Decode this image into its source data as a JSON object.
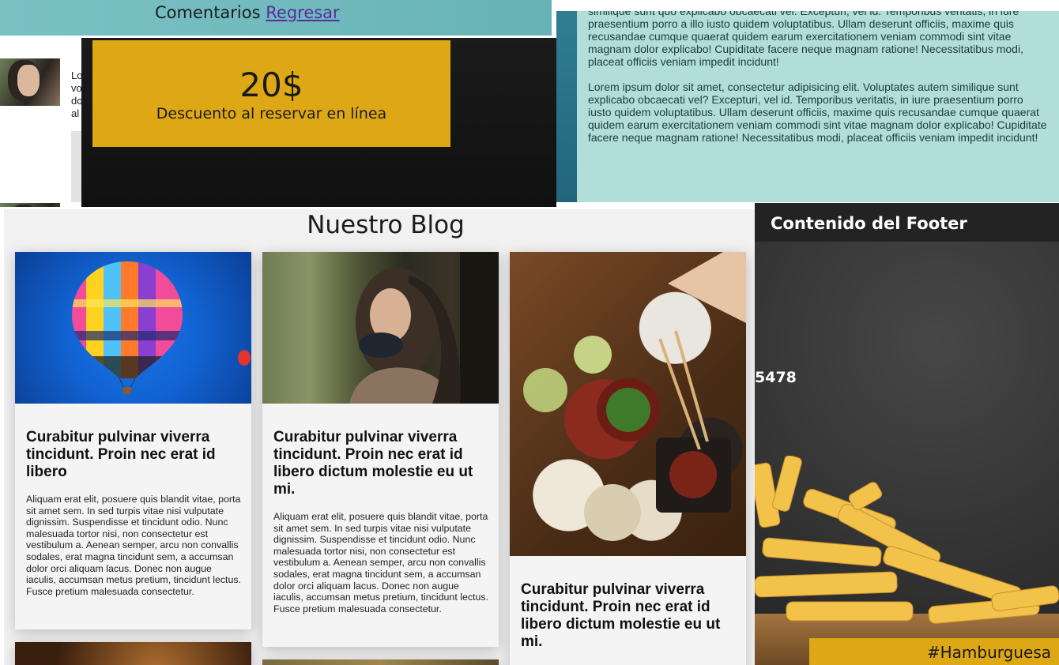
{
  "comments": {
    "title": "Comentarios",
    "back_link": "Regresar",
    "snippet_lines": [
      "Lo",
      "vo",
      "do",
      "al"
    ]
  },
  "discount": {
    "amount": "20$",
    "caption": "Descuento al reservar en línea"
  },
  "lorem": {
    "paragraphs": [
      "similique sunt quo explicabo obcaecati vel. Excepturi, vel id. Temporibus veritatis, in iure",
      "praesentium porro a illo iusto quidem voluptatibus. Ullam deserunt officiis, maxime quis",
      "recusandae cumque quaerat quidem earum exercitationem veniam commodi sint vitae",
      "magnam dolor explicabo! Cupiditate facere neque magnam ratione! Necessitatibus modi,",
      "placeat officiis veniam impedit incidunt!"
    ],
    "paragraphs2": [
      "Lorem ipsum dolor sit amet, consectetur adipisicing elit. Voluptates autem similique sunt",
      "explicabo obcaecati vel? Excepturi, vel id. Temporibus veritatis, in iure praesentium porro",
      "iusto quidem voluptatibus. Ullam deserunt officiis, maxime quis recusandae cumque quaerat",
      "quidem earum exercitationem veniam commodi sint vitae magnam dolor explicabo! Cupiditate",
      "facere neque magnam ratione! Necessitatibus modi, placeat officiis veniam impedit incidunt!"
    ]
  },
  "blog": {
    "heading": "Nuestro Blog",
    "cards": [
      {
        "title": "Curabitur pulvinar viverra tincidunt. Proin nec erat id libero",
        "body": "Aliquam erat elit, posuere quis blandit vitae, porta sit amet sem. In sed turpis vitae nisi vulputate dignissim. Suspendisse et tincidunt odio. Nunc malesuada tortor nisi, non consectetur est vestibulum a. Aenean semper, arcu non convallis sodales, erat magna tincidunt sem, a accumsan dolor orci aliquam lacus. Donec non augue iaculis, accumsan metus pretium, tincidunt lectus. Fusce pretium malesuada consectetur.",
        "image": "hot-air-balloon"
      },
      {
        "title": "Curabitur pulvinar viverra tincidunt. Proin nec erat id libero dictum molestie eu ut mi.",
        "body": "Aliquam erat elit, posuere quis blandit vitae, porta sit amet sem. In sed turpis vitae nisi vulputate dignissim. Suspendisse et tincidunt odio. Nunc malesuada tortor nisi, non consectetur est vestibulum a. Aenean semper, arcu non convallis sodales, erat magna tincidunt sem, a accumsan dolor orci aliquam lacus. Donec non augue iaculis, accumsan metus pretium, tincidunt lectus. Fusce pretium malesuada consectetur.",
        "image": "woman-portrait"
      },
      {
        "title": "Curabitur pulvinar viverra tincidunt. Proin nec erat id libero dictum molestie eu ut mi.",
        "image": "food-table"
      }
    ]
  },
  "footer": {
    "title": "Contenido del Footer",
    "phone_fragment": "5478",
    "tag": "#Hamburguesa"
  },
  "colors": {
    "accent": "#dea715",
    "teal": "#67b3b6",
    "panel": "#b2deda",
    "dark": "#1b1b1b"
  }
}
